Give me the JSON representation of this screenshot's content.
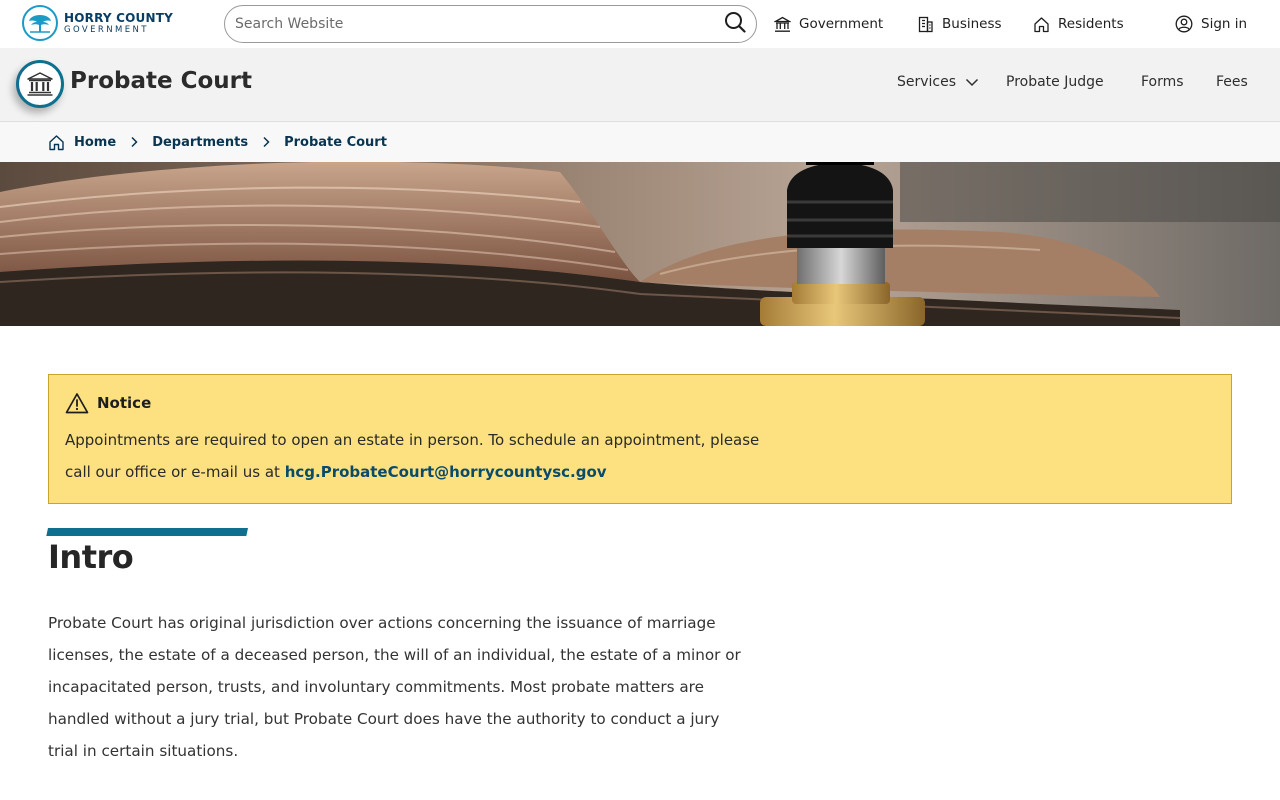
{
  "site": {
    "logo_line1": "HORRY COUNTY",
    "logo_line2": "GOVERNMENT",
    "logo_icon": "tree-icon"
  },
  "search": {
    "placeholder": "Search Website",
    "icon": "search-icon"
  },
  "top_nav": [
    {
      "label": "Government",
      "icon": "capitol-building-icon"
    },
    {
      "label": "Business",
      "icon": "office-building-icon"
    },
    {
      "label": "Residents",
      "icon": "house-icon"
    },
    {
      "label": "Sign in",
      "icon": "user-circle-icon"
    }
  ],
  "department": {
    "title": "Probate Court",
    "icon": "courthouse-icon",
    "nav": [
      {
        "label": "Services",
        "icon": "chevron-down-icon"
      },
      {
        "label": "Probate Judge"
      },
      {
        "label": "Forms"
      },
      {
        "label": "Fees"
      }
    ]
  },
  "breadcrumb": [
    {
      "label": "Home",
      "icon": "home-icon"
    },
    {
      "label": "Departments"
    },
    {
      "label": "Probate Court"
    }
  ],
  "notice": {
    "title": "Notice",
    "icon": "warning-triangle-icon",
    "text": "Appointments are required to open an estate in person. To schedule an appointment, please call our office or e-mail us at",
    "email": "hcg.ProbateCourt@horrycountysc.gov"
  },
  "intro": {
    "title": "Intro",
    "body": "Probate Court has original jurisdiction over actions concerning the issuance of marriage licenses, the estate of a deceased person, the will of an individual, the estate of a minor or incapacitated person, trusts, and involuntary commitments. Most probate matters are handled without a jury trial, but Probate Court does have the authority to conduct a jury trial in certain situations."
  },
  "colors": {
    "brand_teal": "#0e6f8f",
    "notice_bg": "#fde07f",
    "link": "#0a4b69",
    "header_bg": "#f2f2f2"
  }
}
